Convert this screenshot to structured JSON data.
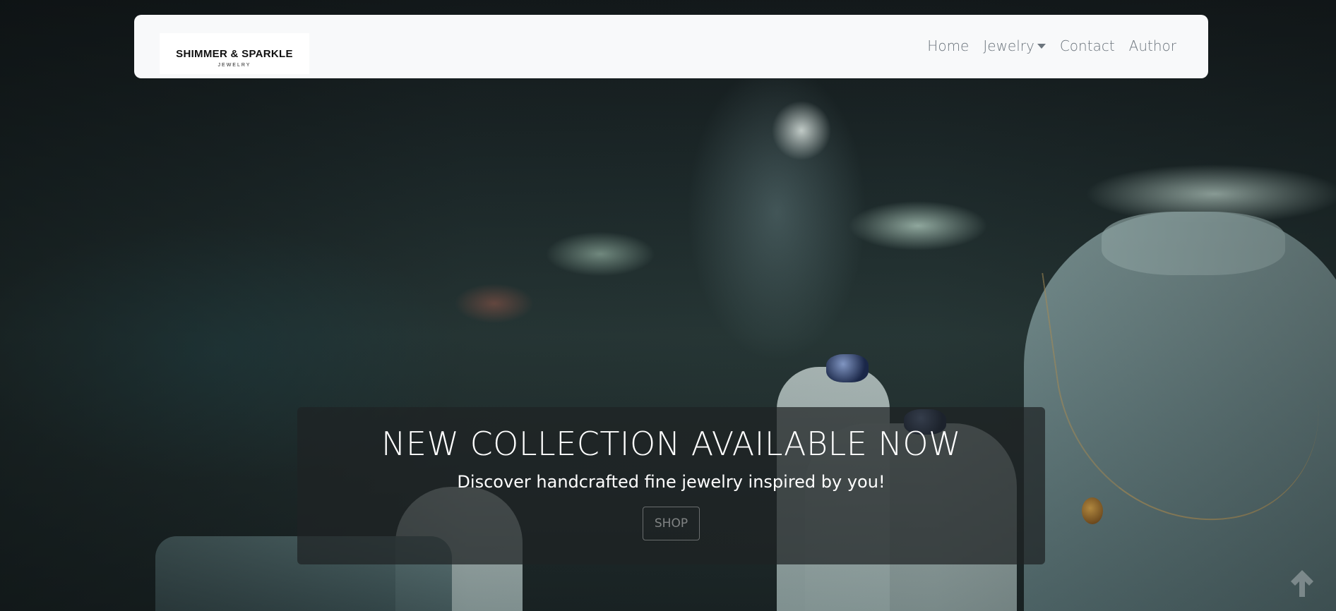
{
  "navbar": {
    "brand": {
      "name": "SHIMMER & SPARKLE",
      "tagline": "JEWELRY"
    },
    "links": {
      "home": "Home",
      "jewelry": "Jewelry",
      "contact": "Contact",
      "author": "Author"
    }
  },
  "hero": {
    "title": "NEW COLLECTION AVAILABLE NOW",
    "subtitle": "Discover handcrafted fine jewelry inspired by you!",
    "cta_label": "SHOP"
  },
  "colors": {
    "navbar_bg": "#f8f9fa",
    "nav_link": "#6c757d",
    "caption_bg": "#1e2224"
  },
  "icons": {
    "dropdown": "caret-down-icon",
    "back_to_top": "arrow-up-icon"
  }
}
